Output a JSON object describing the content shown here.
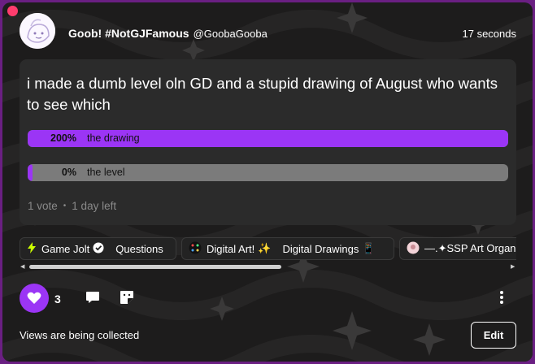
{
  "post": {
    "display_name": "Goob! #NotGJFamous",
    "username": "@GoobaGooba",
    "timestamp": "17 seconds",
    "question": "i made a dumb level oln GD and a stupid drawing of August who wants to see which"
  },
  "poll": {
    "options": [
      {
        "percent_label": "200%",
        "label": "the drawing",
        "fill_fraction": 1.0
      },
      {
        "percent_label": "0%",
        "label": "the level",
        "fill_fraction": 0.01
      }
    ],
    "votes": "1 vote",
    "time_left": "1 day left"
  },
  "tags": [
    {
      "icon": "game-jolt-icon",
      "name": "Game Jolt",
      "badge_icon": "verified-badge-icon",
      "channel": "Questions"
    },
    {
      "icon": "sparkle-art-icon",
      "name": "Digital Art!",
      "emoji": "✨",
      "channel": "Digital Drawings",
      "channel_emoji": "📱"
    },
    {
      "icon": "community-avatar-icon",
      "name": "—.✦SSP Art Organiz"
    }
  ],
  "actions": {
    "like_count": "3",
    "views_text": "Views are being collected",
    "edit_label": "Edit"
  },
  "colors": {
    "accent": "#9b35f5",
    "frame": "#6a1f82",
    "card": "#2b2b2b",
    "background": "#1d1c1c",
    "dot": "#ff3d6e"
  }
}
